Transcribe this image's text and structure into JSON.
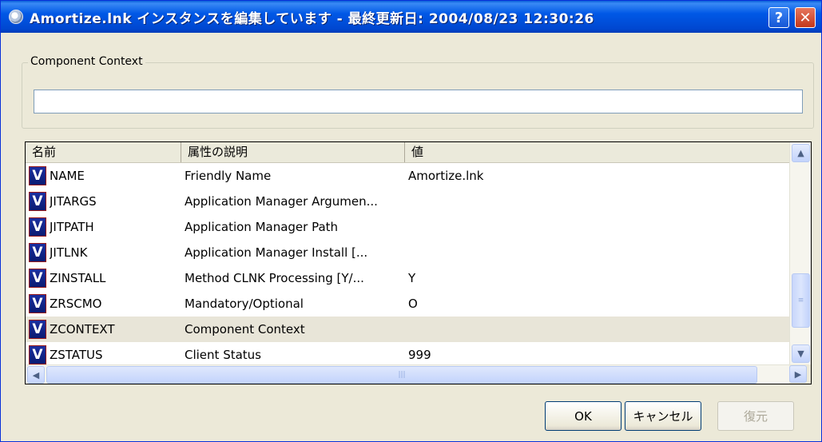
{
  "window": {
    "title": "Amortize.lnk インスタンスを編集しています - 最終更新日: 2004/08/23 12:30:26",
    "help_label": "?",
    "close_label": "✕"
  },
  "context_group": {
    "legend": "Component Context",
    "value": ""
  },
  "table": {
    "columns": [
      "名前",
      "属性の説明",
      "値"
    ],
    "rows": [
      {
        "icon": "V",
        "name": "NAME",
        "description": "Friendly Name",
        "value": "Amortize.lnk"
      },
      {
        "icon": "V",
        "name": "JITARGS",
        "description": "Application Manager Argumen...",
        "value": ""
      },
      {
        "icon": "V",
        "name": "JITPATH",
        "description": "Application Manager Path",
        "value": ""
      },
      {
        "icon": "V",
        "name": "JITLNK",
        "description": "Application Manager Install [...",
        "value": ""
      },
      {
        "icon": "V",
        "name": "ZINSTALL",
        "description": "Method CLNK Processing [Y/...",
        "value": "Y"
      },
      {
        "icon": "V",
        "name": "ZRSCMO",
        "description": "Mandatory/Optional",
        "value": "O"
      },
      {
        "icon": "V",
        "name": "ZCONTEXT",
        "description": "Component Context",
        "value": ""
      },
      {
        "icon": "V",
        "name": "ZSTATUS",
        "description": "Client Status",
        "value": "999"
      }
    ]
  },
  "buttons": {
    "ok": "OK",
    "cancel": "キャンセル",
    "restore": "復元"
  }
}
